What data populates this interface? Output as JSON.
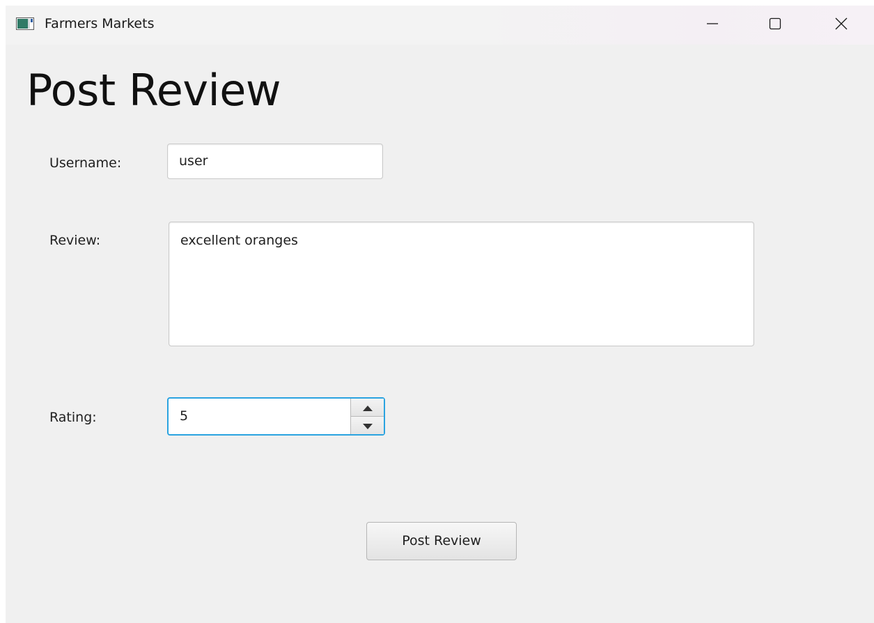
{
  "window": {
    "title": "Farmers Markets",
    "icon": "app-window-icon",
    "controls": {
      "minimize_icon": "minimize-icon",
      "maximize_icon": "maximize-icon",
      "close_icon": "close-icon"
    }
  },
  "page": {
    "title": "Post Review"
  },
  "form": {
    "username": {
      "label": "Username:",
      "value": "user"
    },
    "review": {
      "label": "Review:",
      "value": "excellent oranges"
    },
    "rating": {
      "label": "Rating:",
      "value": "5",
      "up_icon": "chevron-up-icon",
      "down_icon": "chevron-down-icon"
    },
    "submit_label": "Post Review"
  },
  "colors": {
    "background": "#f0f0f0",
    "focus_accent": "#2aa3e0"
  }
}
